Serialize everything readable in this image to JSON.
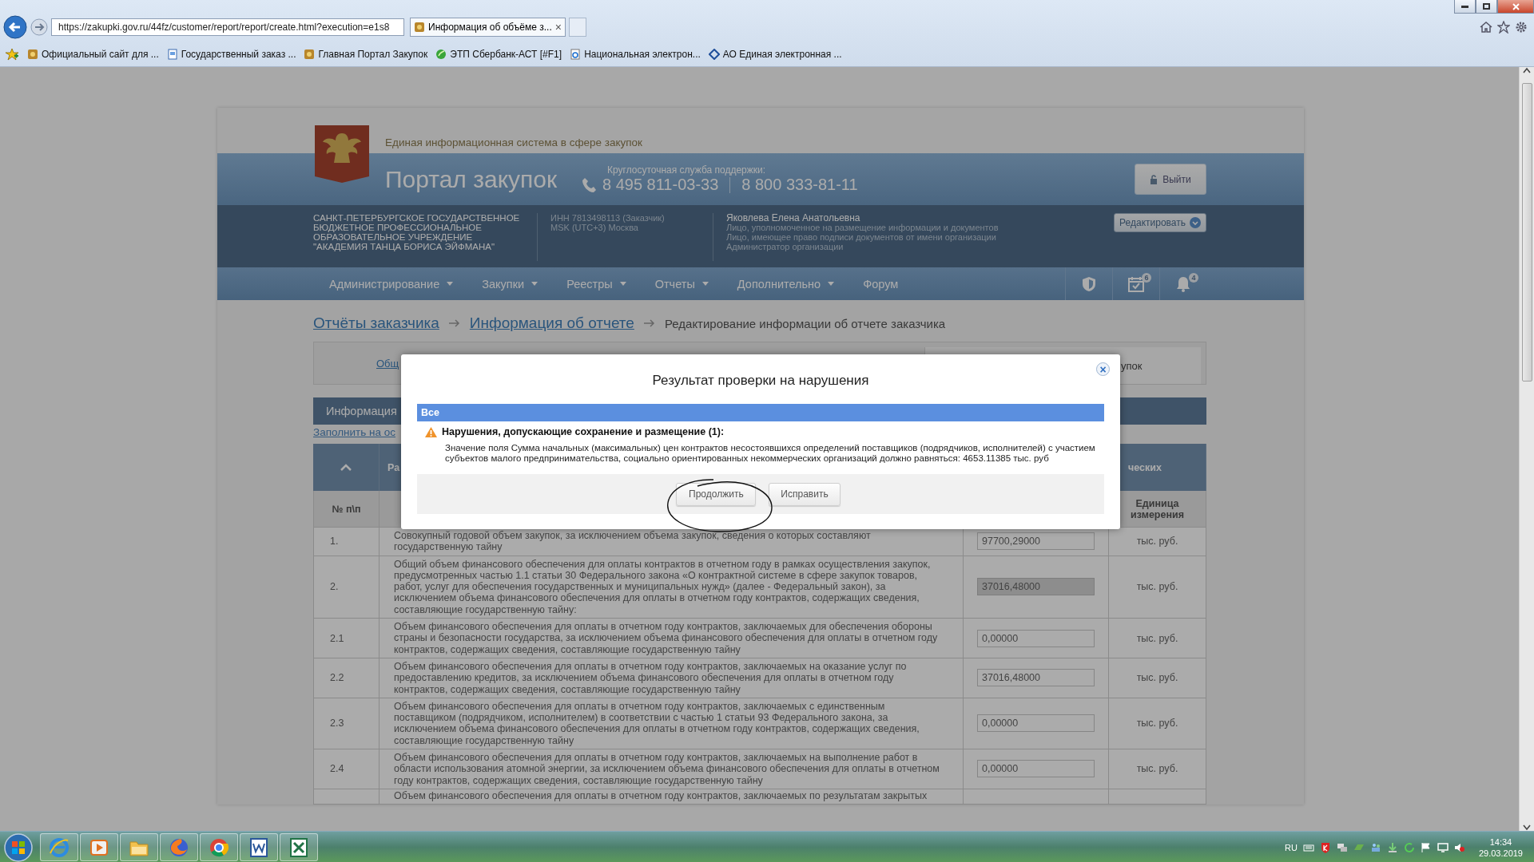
{
  "browser": {
    "url": "https://zakupki.gov.ru/44fz/customer/report/report/create.html?execution=e1s8",
    "tab": {
      "title": "Информация об объёме з...",
      "close": "×"
    },
    "bookmarks": [
      {
        "label": "Официальный сайт для ...",
        "kind": "emblem"
      },
      {
        "label": "Государственный заказ ...",
        "kind": "page"
      },
      {
        "label": "Главная Портал Закупок",
        "kind": "emblem"
      },
      {
        "label": "ЭТП Сбербанк-АСТ [#F1]",
        "kind": "leaf"
      },
      {
        "label": "Национальная электрон...",
        "kind": "ie"
      },
      {
        "label": "АО Единая электронная ...",
        "kind": "diamond"
      }
    ]
  },
  "site": {
    "system_name": "Единая информационная система в сфере закупок",
    "portal_title": "Портал закупок",
    "support_label": "Круглосуточная служба поддержки:",
    "phones": [
      "8 495 811-03-33",
      "8 800 333-81-11"
    ],
    "logout": "Выйти"
  },
  "organization": {
    "name": "САНКТ-ПЕТЕРБУРГСКОЕ ГОСУДАРСТВЕННОЕ БЮДЖЕТНОЕ ПРОФЕССИОНАЛЬНОЕ ОБРАЗОВАТЕЛЬНОЕ УЧРЕЖДЕНИЕ \"АКАДЕМИЯ ТАНЦА БОРИСА ЭЙФМАНА\"",
    "inn": "ИНН 7813498113 (Заказчик)",
    "timezone": "MSK (UTC+3) Москва",
    "user": "Яковлева Елена Анатольевна",
    "roles": [
      "Лицо, уполномоченное на размещение информации и документов",
      "Лицо, имеющее право подписи документов от имени организации",
      "Администратор организации"
    ],
    "edit_button": "Редактировать"
  },
  "nav": {
    "items": [
      {
        "label": "Администрирование",
        "dropdown": true
      },
      {
        "label": "Закупки",
        "dropdown": true
      },
      {
        "label": "Реестры",
        "dropdown": true
      },
      {
        "label": "Отчеты",
        "dropdown": true
      },
      {
        "label": "Дополнительно",
        "dropdown": true
      },
      {
        "label": "Форум",
        "dropdown": false
      }
    ],
    "calendar_badge": "6",
    "notifications_badge": "4"
  },
  "breadcrumbs": [
    {
      "label": "Отчёты заказчика",
      "link": true
    },
    {
      "label": "Информация об отчете",
      "link": true
    },
    {
      "label": "Редактирование информации об отчете заказчика",
      "link": false
    }
  ],
  "tabs": [
    {
      "label": "Общ",
      "selected": false
    },
    {
      "label": "упок",
      "selected": true
    }
  ],
  "section": {
    "title": "Информация",
    "link": "Заполнить на ос"
  },
  "table": {
    "header": {
      "column_2": "Ра",
      "column_4_top": "ческих",
      "number": "№ п\\п",
      "unit": "Единица измерения"
    },
    "rows": [
      {
        "number": "1.",
        "text": "Совокупный годовой объем закупок, за исключением объема закупок, сведения о которых составляют государственную тайну",
        "value": "97700,29000",
        "readonly": false,
        "unit": "тыс. руб."
      },
      {
        "number": "2.",
        "text": "Общий объем финансового обеспечения для оплаты контрактов в отчетном году в рамках осуществления закупок, предусмотренных частью 1.1 статьи 30 Федерального закона «О контрактной системе в сфере закупок товаров, работ, услуг для обеспечения государственных и муниципальных нужд» (далее - Федеральный закон), за исключением объема финансового обеспечения для оплаты в отчетном году контрактов, содержащих сведения, составляющие государственную тайну:",
        "value": "37016,48000",
        "readonly": true,
        "unit": "тыс. руб."
      },
      {
        "number": "2.1",
        "text": "Объем финансового обеспечения для оплаты в отчетном году контрактов, заключаемых для обеспечения обороны страны и безопасности государства, за исключением объема финансового обеспечения для оплаты в отчетном году контрактов, содержащих сведения, составляющие государственную тайну",
        "value": "0,00000",
        "readonly": false,
        "unit": "тыс. руб."
      },
      {
        "number": "2.2",
        "text": "Объем финансового обеспечения для оплаты в отчетном году контрактов, заключаемых на оказание услуг по предоставлению кредитов, за исключением объема финансового обеспечения для оплаты в отчетном году контрактов, содержащих сведения, составляющие государственную тайну",
        "value": "37016,48000",
        "readonly": false,
        "unit": "тыс. руб."
      },
      {
        "number": "2.3",
        "text": "Объем финансового обеспечения для оплаты в отчетном году контрактов, заключаемых с единственным поставщиком (подрядчиком, исполнителем) в соответствии с частью 1 статьи 93 Федерального закона, за исключением объема финансового обеспечения для оплаты в отчетном году контрактов, содержащих сведения, составляющие государственную тайну",
        "value": "0,00000",
        "readonly": false,
        "unit": "тыс. руб."
      },
      {
        "number": "2.4",
        "text": "Объем финансового обеспечения для оплаты в отчетном году контрактов, заключаемых на выполнение работ в области использования атомной энергии, за исключением объема финансового обеспечения для оплаты в отчетном году контрактов, содержащих сведения, составляющие государственную тайну",
        "value": "0,00000",
        "readonly": false,
        "unit": "тыс. руб."
      },
      {
        "text": "Объем финансового обеспечения для оплаты в отчетном году контрактов, заключаемых по результатам закрытых"
      }
    ]
  },
  "dialog": {
    "title": "Результат проверки на нарушения",
    "close": "×",
    "group": "Все",
    "heading": "Нарушения, допускающие сохранение и размещение (1):",
    "message": "Значение поля Сумма начальных (максимальных) цен контрактов несостоявшихся определений поставщиков (подрядчиков, исполнителей) с участием субъектов малого предпринимательства, социально ориентированных некоммерческих организаций должно равняться: 4653.11385 тыс. руб",
    "buttons": [
      "Продолжить",
      "Исправить"
    ]
  },
  "taskbar": {
    "apps": [
      {
        "kind": "ie"
      },
      {
        "kind": "media"
      },
      {
        "kind": "folder"
      },
      {
        "kind": "firefox"
      },
      {
        "kind": "chrome"
      },
      {
        "kind": "word"
      },
      {
        "kind": "excel"
      }
    ],
    "language": "RU",
    "time": "14:34",
    "date": "29.03.2019"
  }
}
